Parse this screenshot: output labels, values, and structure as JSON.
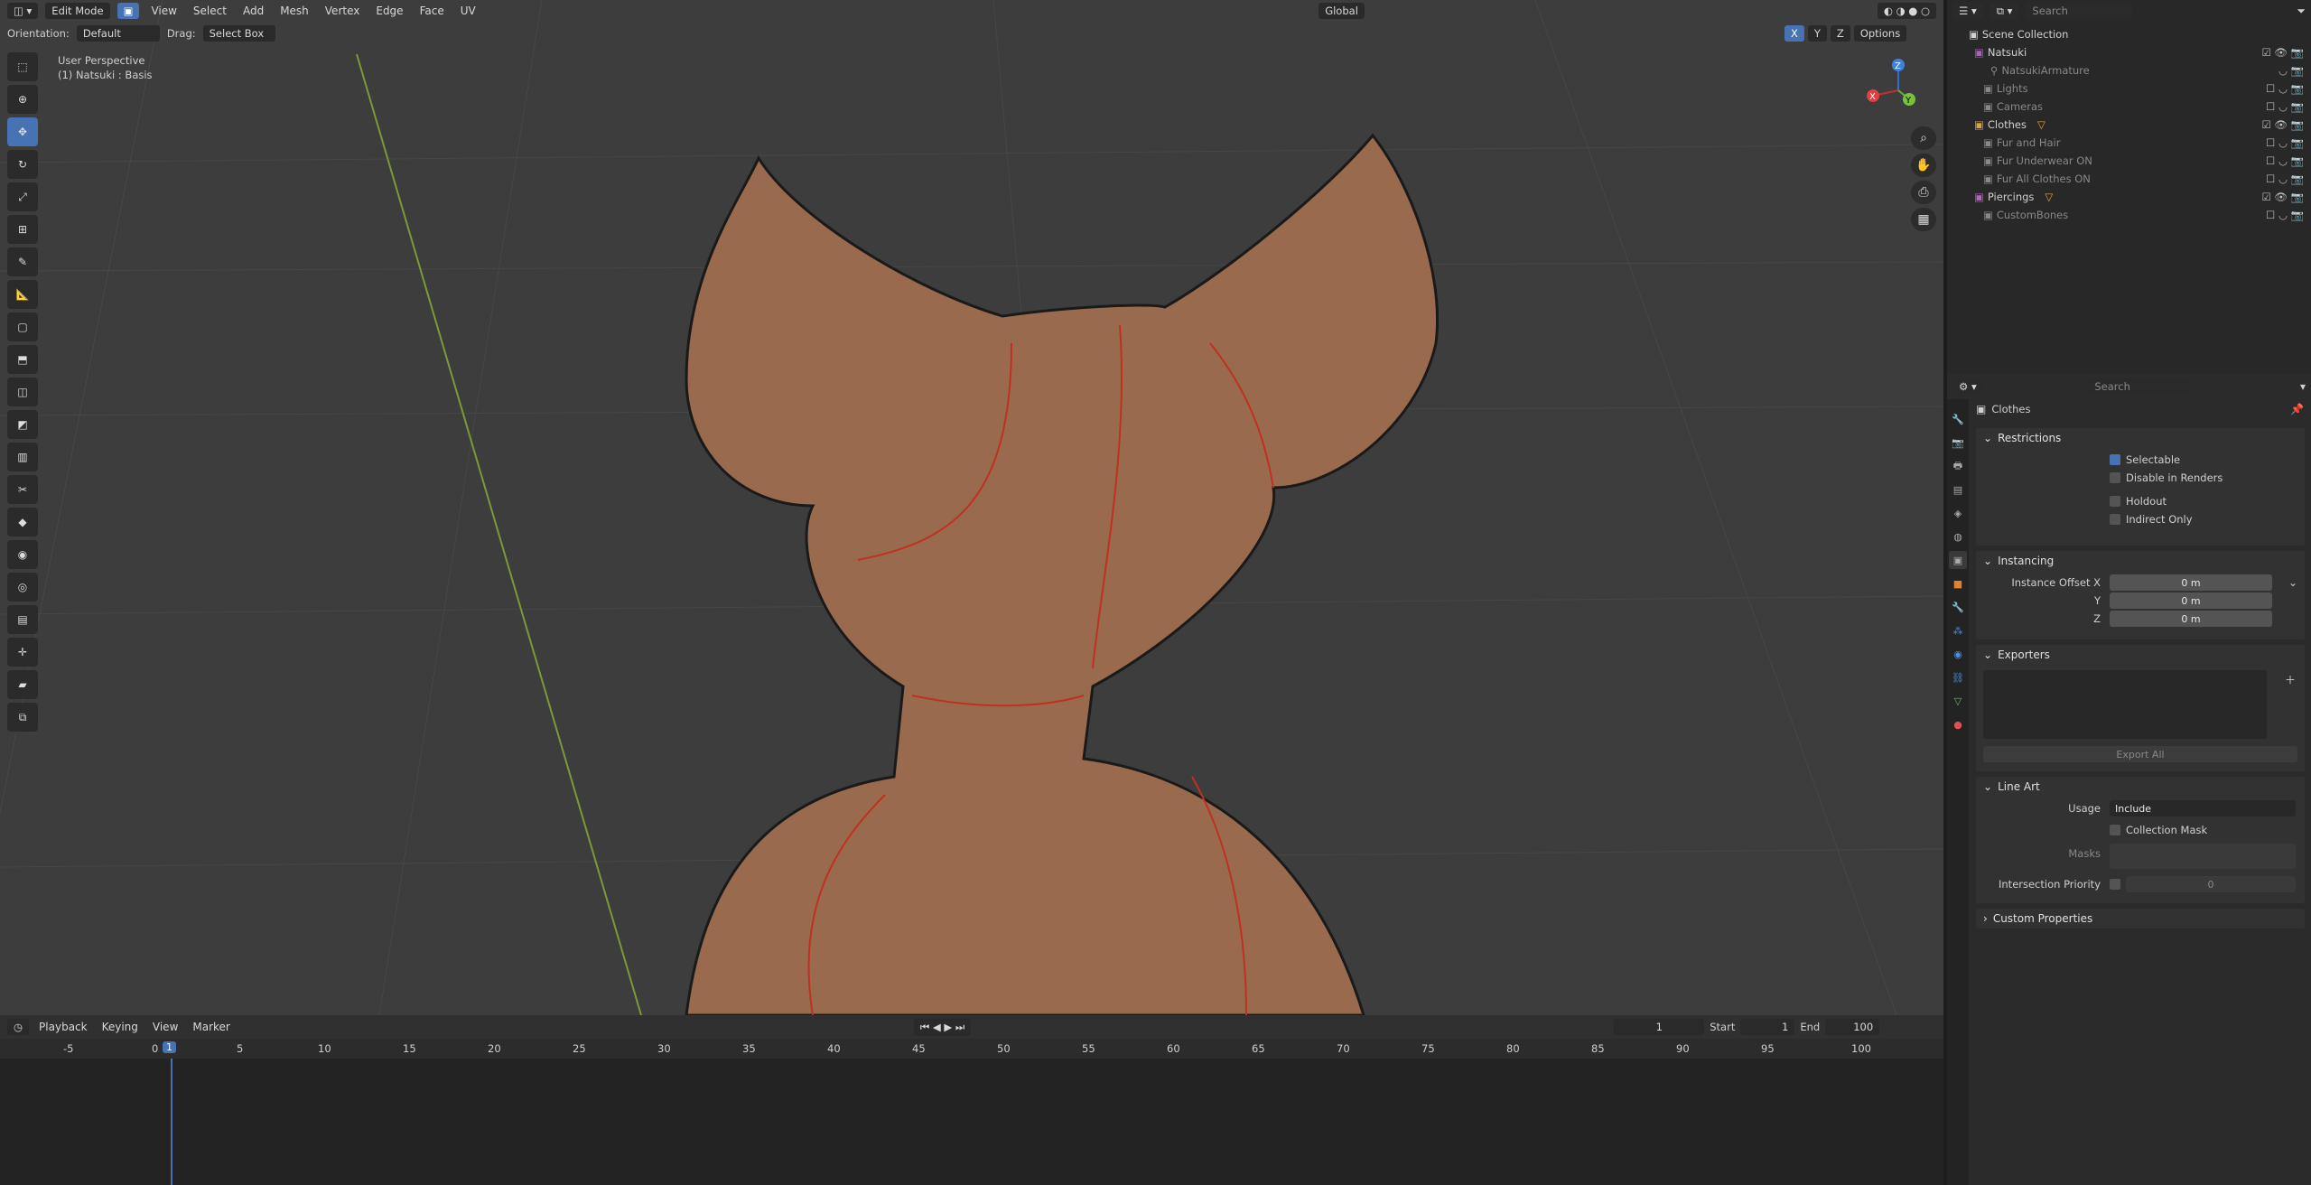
{
  "header": {
    "mode": "Edit Mode",
    "menus": [
      "View",
      "Select",
      "Add",
      "Mesh",
      "Vertex",
      "Edge",
      "Face",
      "UV"
    ],
    "orientation_label": "Orientation:",
    "orientation_value": "Default",
    "drag_label": "Drag:",
    "drag_value": "Select Box",
    "transform": "Global",
    "options": "Options",
    "axes": [
      "X",
      "Y",
      "Z"
    ],
    "search_placeholder": "Search"
  },
  "viewport": {
    "perspective": "User Perspective",
    "object": "(1) Natsuki : Basis",
    "gizmo": {
      "x": "X",
      "y": "Y",
      "z": "Z"
    }
  },
  "timeline": {
    "menus": [
      "Playback",
      "Keying",
      "View",
      "Marker"
    ],
    "current_frame": "1",
    "start_label": "Start",
    "start_value": "1",
    "end_label": "End",
    "end_value": "100",
    "ruler": [
      "-5",
      "0",
      "1",
      "5",
      "10",
      "15",
      "20",
      "25",
      "30",
      "35",
      "40",
      "45",
      "50",
      "55",
      "60",
      "65",
      "70",
      "75",
      "80",
      "85",
      "90",
      "95",
      "100"
    ]
  },
  "outliner": {
    "search_placeholder": "Search",
    "items": [
      {
        "label": "Scene Collection",
        "level": 0,
        "color": "#c8c8c8"
      },
      {
        "label": "Natsuki",
        "level": 1,
        "color": "#b05cc8",
        "enabled": true
      },
      {
        "label": "NatsukiArmature",
        "level": 2,
        "color": "#808080",
        "enabled": false
      },
      {
        "label": "Lights",
        "level": 1,
        "color": "#808080",
        "enabled": false
      },
      {
        "label": "Cameras",
        "level": 1,
        "color": "#808080",
        "enabled": false
      },
      {
        "label": "Clothes",
        "level": 1,
        "color": "#e0a040",
        "enabled": true
      },
      {
        "label": "Fur and Hair",
        "level": 1,
        "color": "#808080",
        "enabled": false
      },
      {
        "label": "Fur Underwear ON",
        "level": 1,
        "color": "#808080",
        "enabled": false
      },
      {
        "label": "Fur All Clothes ON",
        "level": 1,
        "color": "#808080",
        "enabled": false
      },
      {
        "label": "Piercings",
        "level": 1,
        "color": "#c05cc8",
        "enabled": true
      },
      {
        "label": "CustomBones",
        "level": 1,
        "color": "#808080",
        "enabled": false
      }
    ]
  },
  "properties": {
    "search_placeholder": "Search",
    "collection": "Clothes",
    "restrictions": {
      "title": "Restrictions",
      "selectable": "Selectable",
      "disable_renders": "Disable in Renders",
      "holdout": "Holdout",
      "indirect_only": "Indirect Only"
    },
    "instancing": {
      "title": "Instancing",
      "offset_x_label": "Instance Offset X",
      "y_label": "Y",
      "z_label": "Z",
      "x": "0 m",
      "y": "0 m",
      "z": "0 m"
    },
    "exporters": {
      "title": "Exporters",
      "export_all": "Export All"
    },
    "line_art": {
      "title": "Line Art",
      "usage_label": "Usage",
      "usage_value": "Include",
      "collection_mask": "Collection Mask",
      "masks": "Masks",
      "intersection_priority": "Intersection Priority",
      "priority_value": "0"
    },
    "custom_properties": "Custom Properties"
  }
}
